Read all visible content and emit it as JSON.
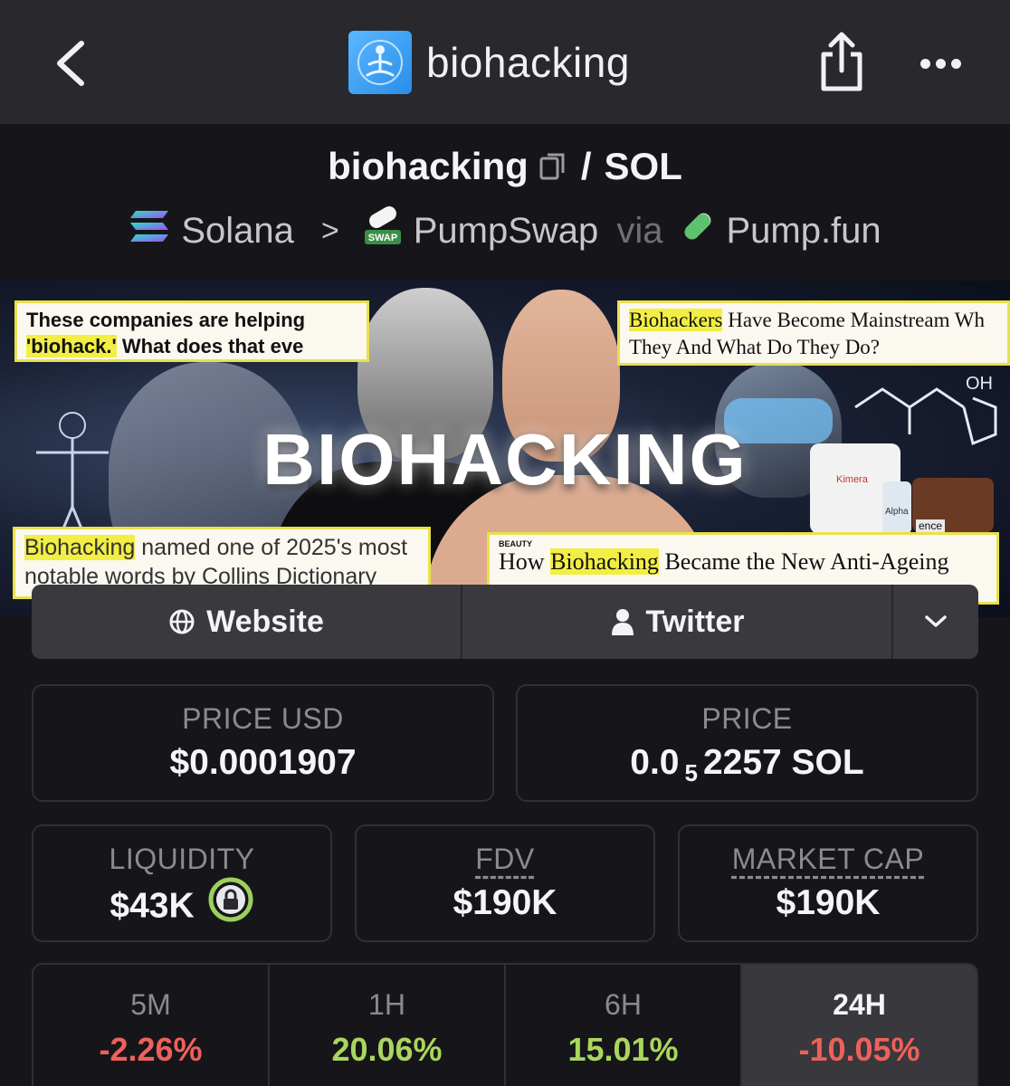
{
  "header": {
    "title": "biohacking"
  },
  "pair": {
    "base": "biohacking",
    "quote": "SOL",
    "separator": "/"
  },
  "breadcrumb": {
    "chain": "Solana",
    "chevron": ">",
    "dex": "PumpSwap",
    "dex_badge": "SWAP",
    "via": "via",
    "launchpad": "Pump.fun"
  },
  "banner": {
    "title": "BIOHACKING",
    "headlines": [
      {
        "pre": "These companies are helping",
        "hl": "'biohack.'",
        "post": " What does that eve"
      },
      {
        "hl": "Biohackers",
        "post": " Have Become Mainstream Wh",
        "line2": "They And What Do They Do?"
      },
      {
        "hl": "Biohacking",
        "post": " named one of 2025's most",
        "line2": "notable words by Collins Dictionary"
      },
      {
        "tag": "BEAUTY",
        "pre": "How ",
        "hl": "Biohacking",
        "post": " Became the New Anti-Ageing"
      }
    ],
    "product_labels": [
      "Kimera",
      "Alpha",
      "ence"
    ],
    "chem_label": "OH"
  },
  "links": {
    "website": "Website",
    "twitter": "Twitter"
  },
  "stats": {
    "price_usd_label": "PRICE USD",
    "price_usd": "$0.0001907",
    "price_label": "PRICE",
    "price_prefix": "0.0",
    "price_zeros": "5",
    "price_suffix": "2257 SOL",
    "liquidity_label": "LIQUIDITY",
    "liquidity": "$43K",
    "fdv_label": "FDV",
    "fdv": "$190K",
    "mcap_label": "MARKET CAP",
    "mcap": "$190K"
  },
  "timeframes": [
    {
      "label": "5M",
      "change": "-2.26%",
      "trend": "down"
    },
    {
      "label": "1H",
      "change": "20.06%",
      "trend": "up"
    },
    {
      "label": "6H",
      "change": "15.01%",
      "trend": "up"
    },
    {
      "label": "24H",
      "change": "-10.05%",
      "trend": "down",
      "active": true
    }
  ],
  "colors": {
    "negative": "#f0605a",
    "positive": "#a9d65c",
    "lock_green": "#9ccf5e"
  }
}
